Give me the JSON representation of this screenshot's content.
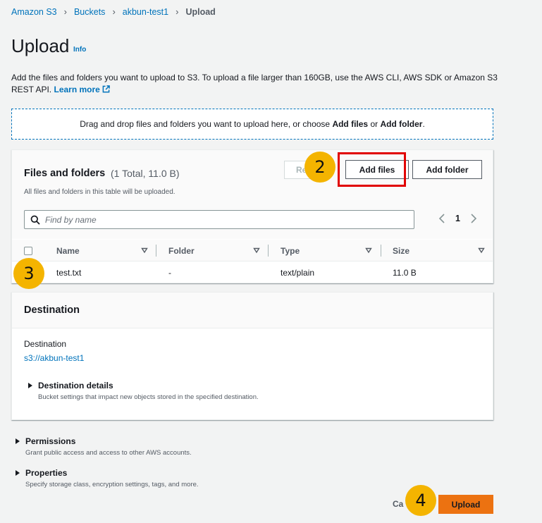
{
  "breadcrumb": {
    "items": [
      "Amazon S3",
      "Buckets",
      "akbun-test1"
    ],
    "current": "Upload"
  },
  "page": {
    "title": "Upload",
    "info": "Info",
    "intro_text": "Add the files and folders you want to upload to S3. To upload a file larger than 160GB, use the AWS CLI, AWS SDK or Amazon S3 REST API.",
    "learn_more": "Learn more"
  },
  "dropzone": {
    "text_prefix": "Drag and drop files and folders you want to upload here, or choose ",
    "add_files": "Add files",
    "or": " or ",
    "add_folder": "Add folder",
    "suffix": "."
  },
  "files": {
    "title": "Files and folders",
    "count": "(1 Total, 11.0 B)",
    "description": "All files and folders in this table will be uploaded.",
    "remove_label": "Re",
    "add_files_label": "Add files",
    "add_folder_label": "Add folder",
    "search_placeholder": "Find by name",
    "page": "1",
    "columns": [
      "Name",
      "Folder",
      "Type",
      "Size"
    ],
    "rows": [
      {
        "name": "test.txt",
        "folder": "-",
        "type": "text/plain",
        "size": "11.0 B"
      }
    ]
  },
  "destination": {
    "title": "Destination",
    "label": "Destination",
    "value": "s3://akbun-test1",
    "details_title": "Destination details",
    "details_desc": "Bucket settings that impact new objects stored in the specified destination."
  },
  "permissions": {
    "title": "Permissions",
    "desc": "Grant public access and access to other AWS accounts."
  },
  "properties": {
    "title": "Properties",
    "desc": "Specify storage class, encryption settings, tags, and more."
  },
  "footer": {
    "cancel": "Ca",
    "upload": "Upload"
  },
  "annotations": {
    "step2": "2",
    "step3": "3",
    "step4": "4"
  },
  "colors": {
    "link": "#0073bb",
    "primary": "#ec7211",
    "badge": "#f4b400",
    "highlight": "#e10000"
  }
}
